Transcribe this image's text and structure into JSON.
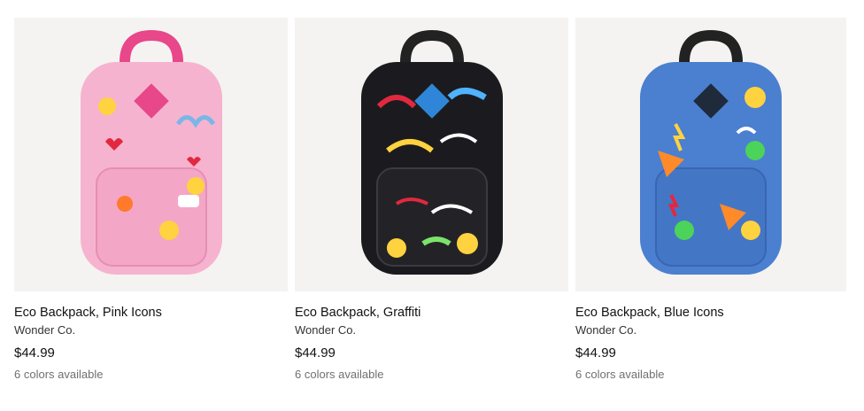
{
  "products": [
    {
      "name": "Eco Backpack, Pink Icons",
      "brand": "Wonder Co.",
      "price": "$44.99",
      "colors": "6 colors available",
      "image_icon": "pink-backpack-image",
      "body_color": "#f6b3cf",
      "accent_color": "#e8478a"
    },
    {
      "name": "Eco Backpack, Graffiti",
      "brand": "Wonder Co.",
      "price": "$44.99",
      "colors": "6 colors available",
      "image_icon": "graffiti-backpack-image",
      "body_color": "#1b1b1f",
      "accent_color": "#2f86d8"
    },
    {
      "name": "Eco Backpack, Blue Icons",
      "brand": "Wonder Co.",
      "price": "$44.99",
      "colors": "6 colors available",
      "image_icon": "blue-backpack-image",
      "body_color": "#4b7fd0",
      "accent_color": "#1f3f7a"
    }
  ]
}
